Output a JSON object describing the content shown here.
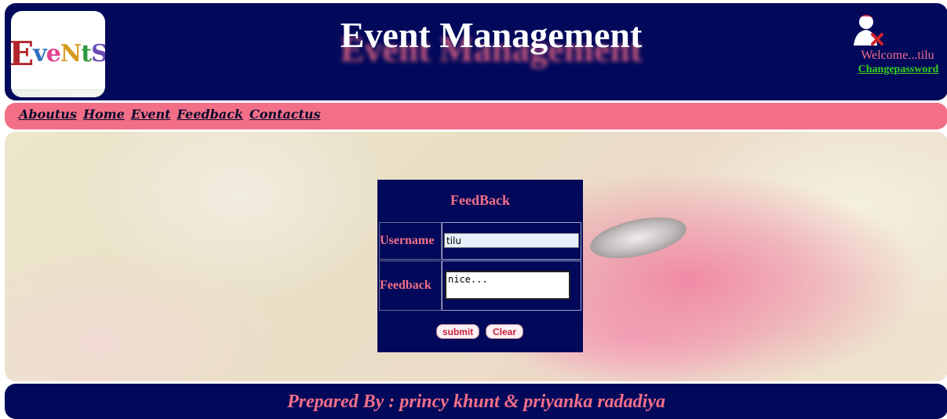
{
  "header": {
    "logo_text": "EveNtS",
    "title": "Event Management",
    "welcome": "Welcome...tilu",
    "change_password": "Changepassword"
  },
  "nav": {
    "items": [
      "Aboutus",
      "Home",
      "Event",
      "Feedback",
      "Contactus"
    ]
  },
  "form": {
    "title": "FeedBack",
    "username_label": "Username",
    "username_value": "tilu",
    "feedback_label": "Feedback",
    "feedback_value": "nice...",
    "submit_label": "submit",
    "clear_label": "Clear"
  },
  "footer": {
    "text": "Prepared By : princy khunt & priyanka radadiya"
  },
  "colors": {
    "navy": "#02095a",
    "pink": "#f36f88",
    "green_link": "#35d11f"
  },
  "icons": {
    "user_icon": "user-remove-icon"
  }
}
